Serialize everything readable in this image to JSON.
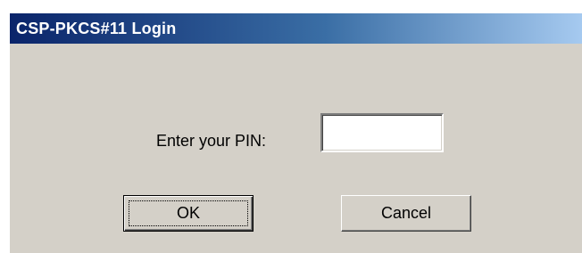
{
  "window": {
    "title": "CSP-PKCS#11 Login"
  },
  "form": {
    "pin_label": "Enter your PIN:",
    "pin_value": "",
    "pin_placeholder": ""
  },
  "buttons": {
    "ok_label": "OK",
    "cancel_label": "Cancel"
  },
  "colors": {
    "titlebar_start": "#0a246a",
    "titlebar_end": "#a6caf0",
    "dialog_background": "#d4d0c8",
    "title_text": "#ffffff"
  }
}
